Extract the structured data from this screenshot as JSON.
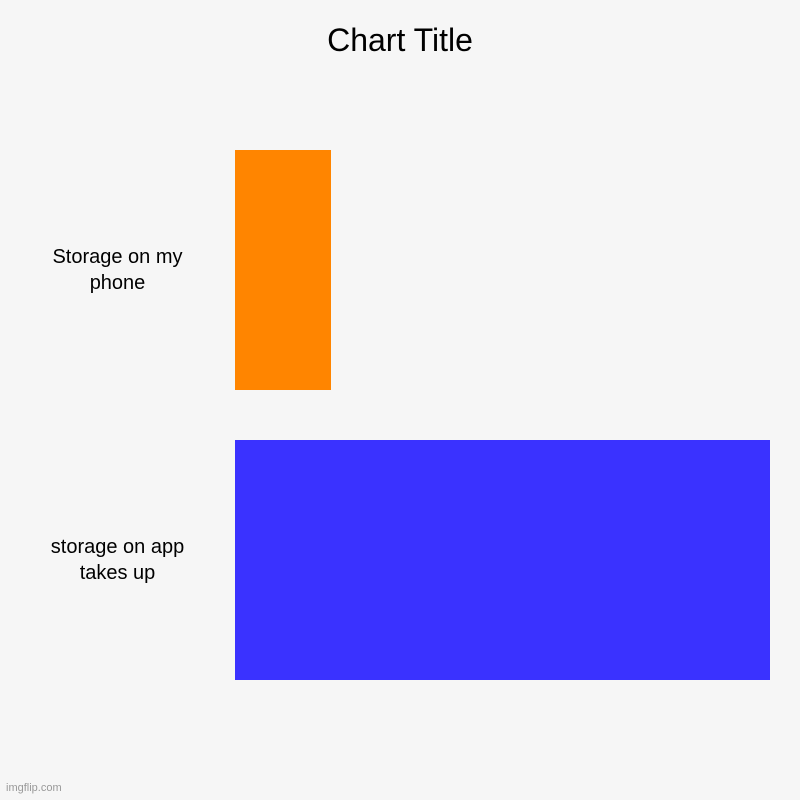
{
  "chart_data": {
    "type": "bar",
    "title": "Chart Title",
    "orientation": "horizontal",
    "categories": [
      "Storage on my phone",
      "storage on app takes up"
    ],
    "values": [
      18,
      100
    ],
    "colors": [
      "#ff8500",
      "#3a32ff"
    ],
    "xlabel": "",
    "ylabel": "",
    "xlim": [
      0,
      100
    ]
  },
  "watermark": "imgflip.com"
}
